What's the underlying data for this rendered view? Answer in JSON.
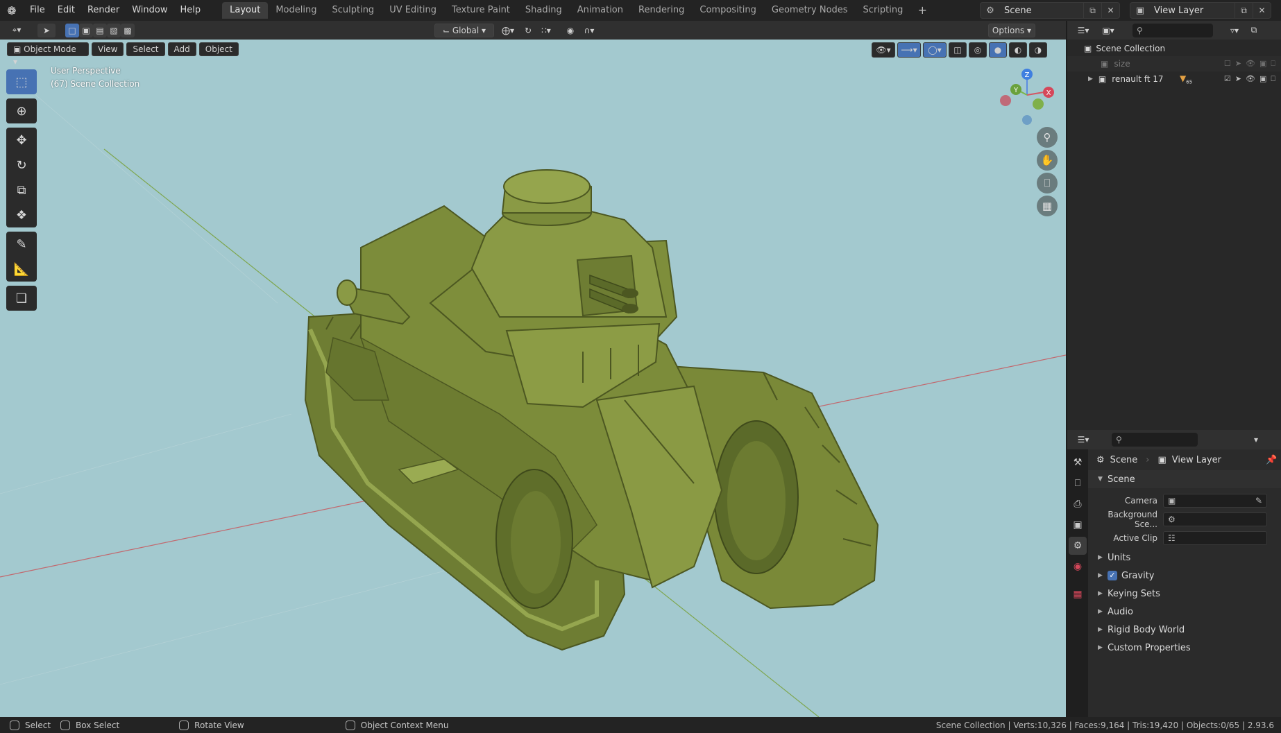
{
  "menu": [
    "File",
    "Edit",
    "Render",
    "Window",
    "Help"
  ],
  "workspaces": [
    "Layout",
    "Modeling",
    "Sculpting",
    "UV Editing",
    "Texture Paint",
    "Shading",
    "Animation",
    "Rendering",
    "Compositing",
    "Geometry Nodes",
    "Scripting"
  ],
  "active_workspace": "Layout",
  "scene_name": "Scene",
  "view_layer_name": "View Layer",
  "viewport_header": {
    "transform_orientation": "Global",
    "options_label": "Options"
  },
  "mode_bar": {
    "mode": "Object Mode",
    "view": "View",
    "select": "Select",
    "add": "Add",
    "object": "Object"
  },
  "viewport_info": {
    "perspective": "User Perspective",
    "collection": "(67) Scene Collection"
  },
  "gizmo_axes": [
    "Z",
    "Y",
    "X"
  ],
  "outliner": {
    "root": "Scene Collection",
    "items": [
      {
        "name": "size",
        "visible": false
      },
      {
        "name": "renault ft 17",
        "visible": true
      }
    ],
    "item_badge": "65"
  },
  "properties": {
    "breadcrumb_scene": "Scene",
    "breadcrumb_view_layer": "View Layer",
    "panel_title": "Scene",
    "fields": [
      {
        "label": "Camera",
        "value": ""
      },
      {
        "label": "Background Sce...",
        "value": ""
      },
      {
        "label": "Active Clip",
        "value": ""
      }
    ],
    "subpanels": [
      "Units",
      "Gravity",
      "Keying Sets",
      "Audio",
      "Rigid Body World",
      "Custom Properties"
    ],
    "gravity_enabled": true
  },
  "statusbar": {
    "select": "Select",
    "box_select": "Box Select",
    "rotate_view": "Rotate View",
    "context_menu": "Object Context Menu",
    "stats": "Scene Collection | Verts:10,326 | Faces:9,164 | Tris:19,420 | Objects:0/65 | 2.93.6"
  },
  "colors": {
    "accent": "#4772b3",
    "viewport_bg": "#a3c9cf",
    "model": "#7f8f3e"
  }
}
